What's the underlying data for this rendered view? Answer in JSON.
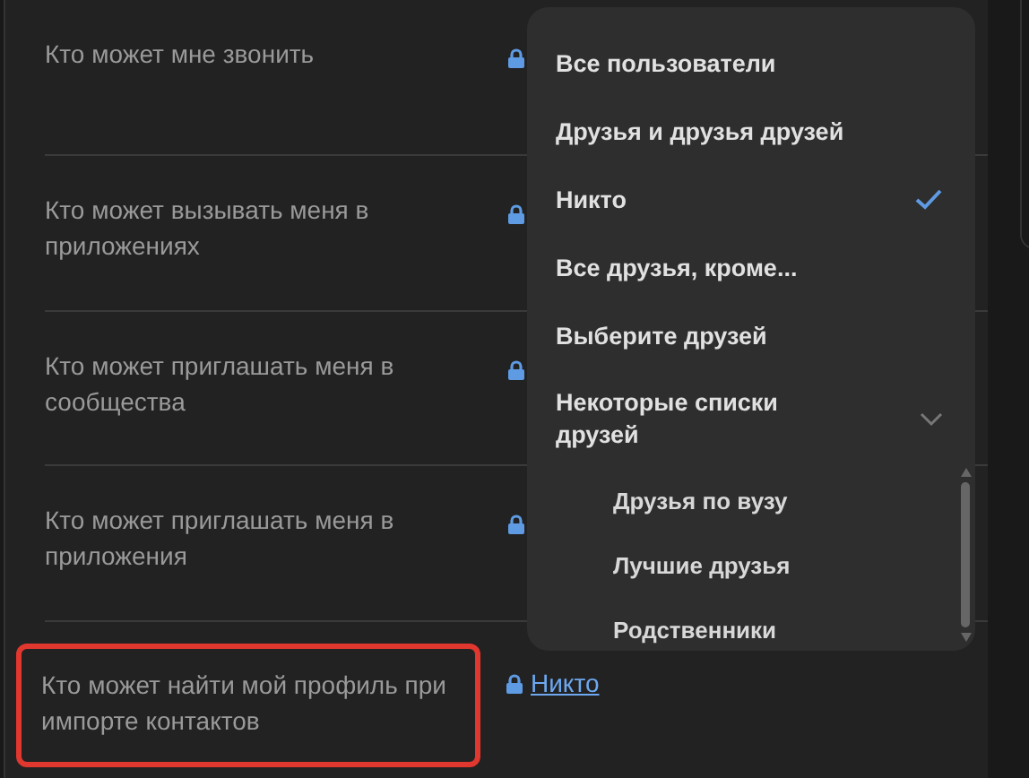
{
  "settings": [
    {
      "label": "Кто может мне звонить",
      "highlighted": false
    },
    {
      "label": "Кто может вызывать меня в приложениях",
      "highlighted": false
    },
    {
      "label": "Кто может приглашать меня в сообщества",
      "highlighted": false
    },
    {
      "label": "Кто может приглашать меня в приложения",
      "highlighted": false
    },
    {
      "label": "Кто может найти мой профиль при импорте контактов",
      "highlighted": true,
      "value": "Никто"
    }
  ],
  "dropdown": {
    "items": [
      {
        "kind": "option",
        "label": "Все пользователи",
        "selected": false
      },
      {
        "kind": "option",
        "label": "Друзья и друзья друзей",
        "selected": false
      },
      {
        "kind": "option",
        "label": "Никто",
        "selected": true
      },
      {
        "kind": "option",
        "label": "Все друзья, кроме...",
        "selected": false
      },
      {
        "kind": "option",
        "label": "Выберите друзей",
        "selected": false
      },
      {
        "kind": "group",
        "label": "Некоторые списки друзей",
        "expanded": true,
        "children": [
          {
            "label": "Друзья по вузу",
            "selected": false
          },
          {
            "label": "Лучшие друзья",
            "selected": false
          },
          {
            "label": "Родственники",
            "selected": false
          }
        ]
      }
    ]
  }
}
